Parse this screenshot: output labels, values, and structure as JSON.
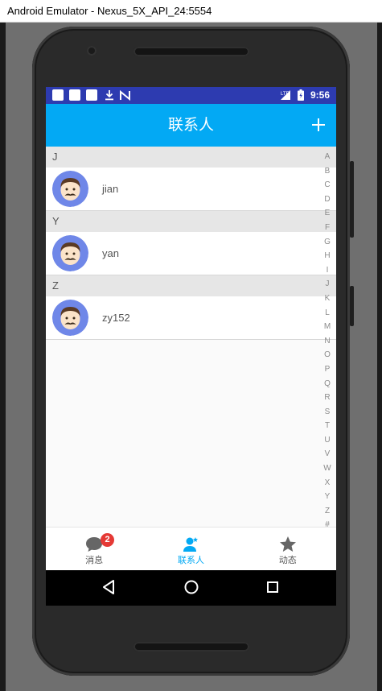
{
  "window": {
    "title": "Android Emulator - Nexus_5X_API_24:5554"
  },
  "status_bar": {
    "time": "9:56",
    "icons": [
      "notification-square-icon",
      "notification-square-icon",
      "notification-square-icon",
      "download-icon",
      "n-icon",
      "lte-signal-icon",
      "battery-icon"
    ]
  },
  "app_bar": {
    "title": "联系人",
    "add_icon": "plus-icon"
  },
  "contacts": {
    "sections": [
      {
        "letter": "J",
        "items": [
          {
            "name": "jian"
          }
        ]
      },
      {
        "letter": "Y",
        "items": [
          {
            "name": "yan"
          }
        ]
      },
      {
        "letter": "Z",
        "items": [
          {
            "name": "zy152"
          }
        ]
      }
    ]
  },
  "index_bar": {
    "letters": [
      "A",
      "B",
      "C",
      "D",
      "E",
      "F",
      "G",
      "H",
      "I",
      "J",
      "K",
      "L",
      "M",
      "N",
      "O",
      "P",
      "Q",
      "R",
      "S",
      "T",
      "U",
      "V",
      "W",
      "X",
      "Y",
      "Z",
      "#"
    ]
  },
  "bottom_nav": {
    "items": [
      {
        "label": "消息",
        "icon": "chat-bubble-icon",
        "badge": "2"
      },
      {
        "label": "联系人",
        "icon": "contact-icon",
        "active": true
      },
      {
        "label": "动态",
        "icon": "star-icon"
      }
    ]
  },
  "colors": {
    "accent": "#03a9f4",
    "status_bar": "#2d3bb0",
    "badge": "#e53935",
    "avatar_bg": "#6f87e8"
  }
}
